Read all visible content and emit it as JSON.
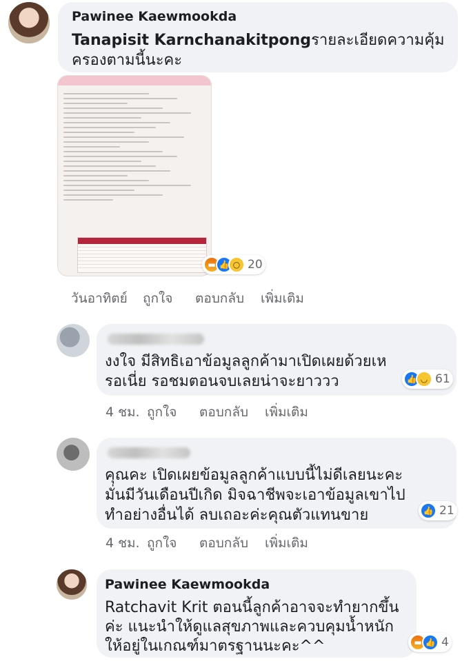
{
  "comments": [
    {
      "author": "Pawinee Kaewmookda",
      "mention": "Tanapisit Karnchanakitpong",
      "lines": [
        "รายละเอียดความคุ้ม",
        "ครองตามนี้นะคะ"
      ],
      "actions": {
        "time": "วันอาทิตย์",
        "like": "ถูกใจ",
        "reply": "ตอบกลับ",
        "more": "เพิ่มเติม"
      },
      "reactions": {
        "icons": [
          "angry-icon",
          "like-icon",
          "wow-icon"
        ],
        "count": "20"
      }
    },
    {
      "author": "",
      "lines": [
        "งงใจ มีสิทธิเอาข้อมูลลูกค้ามาเปิดเผยด้วยเห",
        "รอเนี่ย รอชมตอนจบเลยน่าจะยาววว"
      ],
      "actions": {
        "time": "4 ชม.",
        "like": "ถูกใจ",
        "reply": "ตอบกลับ",
        "more": "เพิ่มเติม"
      },
      "reactions": {
        "icons": [
          "like-icon",
          "haha-icon"
        ],
        "count": "61"
      }
    },
    {
      "author": "",
      "lines": [
        "คุณคะ เปิดเผยข้อมูลลูกค้าแบบนี้ไม่ดีเลยนะคะ",
        "มั่นมีวันเดือนปีเกิด มิจฉาชีพจะเอาข้อมูลเขาไป",
        "ทำอย่างอื่นได้ ลบเถอะค่ะคุณตัวแทนขาย"
      ],
      "actions": {
        "time": "4 ชม.",
        "like": "ถูกใจ",
        "reply": "ตอบกลับ",
        "more": "เพิ่มเติม"
      },
      "reactions": {
        "icons": [
          "like-icon"
        ],
        "count": "21"
      }
    },
    {
      "author": "Pawinee Kaewmookda",
      "lines": [
        "Ratchavit Krit ตอนนี้ลูกค้าอาจจะทำยากขึ้น",
        "ค่ะ แนะนำให้ดูแลสุขภาพและควบคุมน้ำหนัก",
        "ให้อยู่ในเกณฑ์มาตรฐานนะคะ^^"
      ],
      "reactions": {
        "icons": [
          "angry-icon",
          "like-icon"
        ],
        "count": "4"
      }
    }
  ],
  "attachment": {
    "kind": "document-screenshot"
  },
  "colors": {
    "bubble": "#f0f2f5",
    "like": "#1877f2",
    "muted": "#65676b"
  }
}
